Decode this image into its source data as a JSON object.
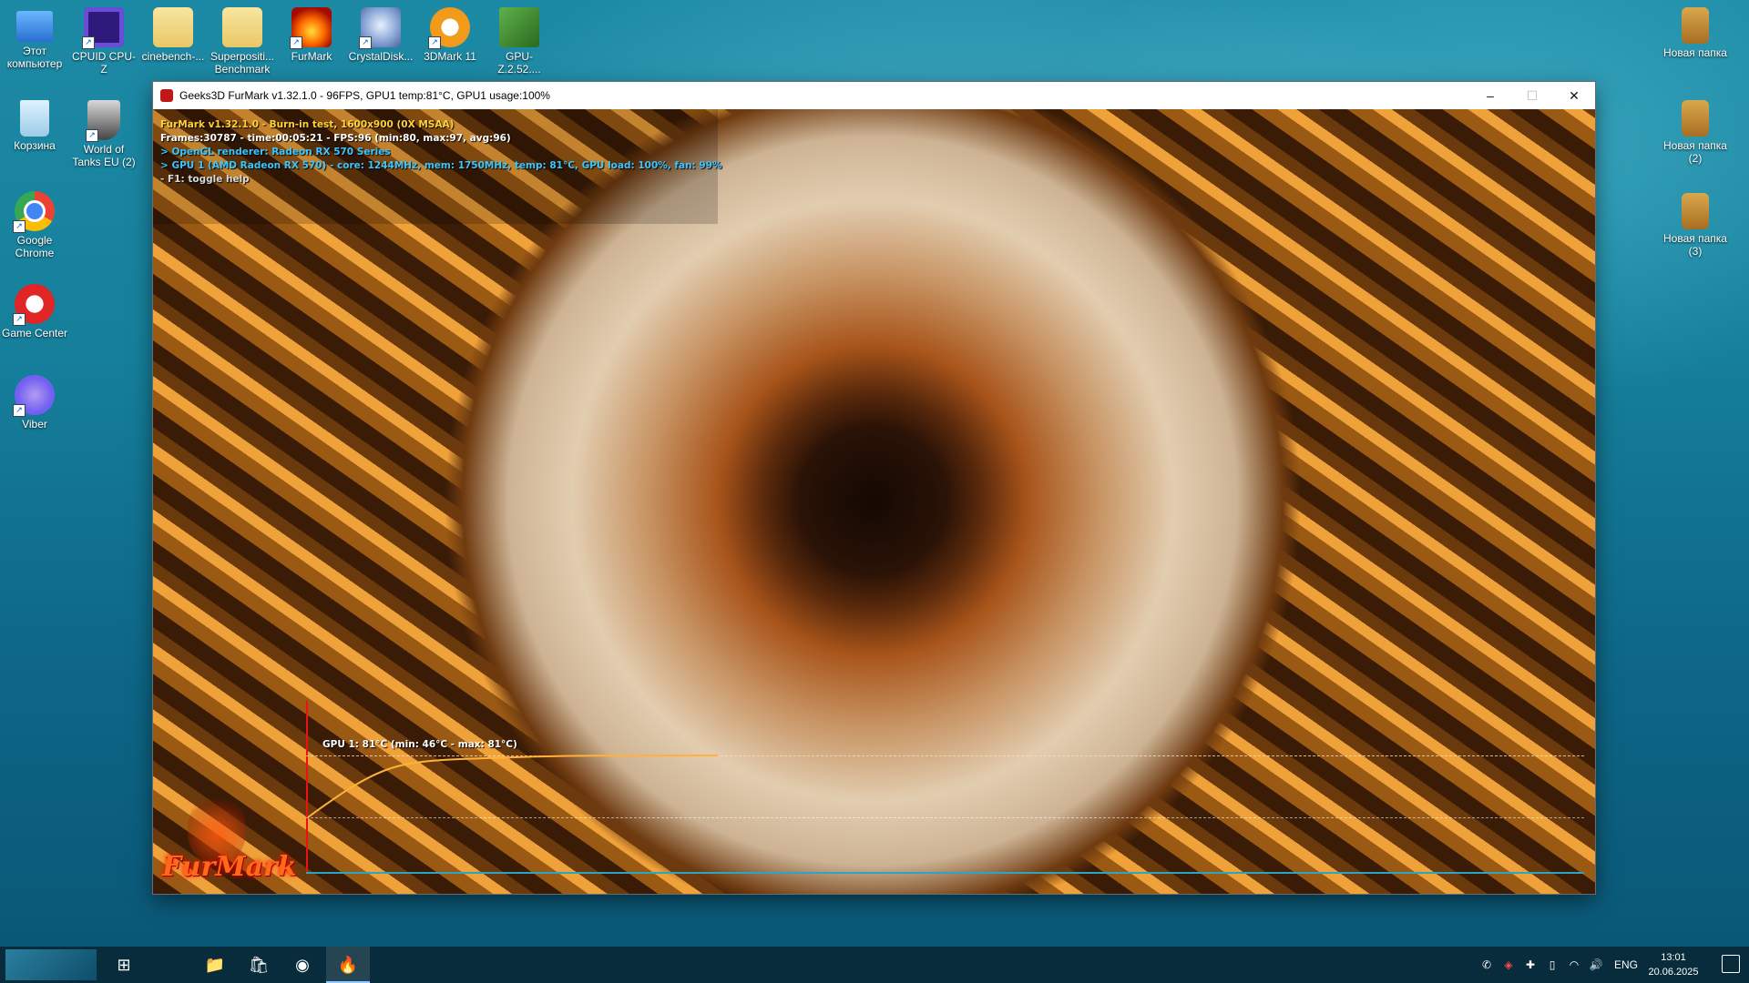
{
  "desktop": {
    "left_icons": [
      {
        "label": "Этот компьютер",
        "icon": "computer-icon"
      },
      {
        "label": "CPUID CPU-Z",
        "icon": "cpu-z-icon"
      },
      {
        "label": "cinebench-...",
        "icon": "folder-icon"
      },
      {
        "label": "Superpositi... Benchmark",
        "icon": "folder-icon"
      },
      {
        "label": "FurMark",
        "icon": "furmark-icon"
      },
      {
        "label": "CrystalDisk...",
        "icon": "crystaldisk-icon"
      },
      {
        "label": "3DMark 11",
        "icon": "3dmark-icon"
      },
      {
        "label": "GPU-Z.2.52....",
        "icon": "gpu-z-icon"
      },
      {
        "label": "Корзина",
        "icon": "recycle-bin-icon"
      },
      {
        "label": "World of Tanks EU (2)",
        "icon": "world-of-tanks-icon"
      },
      {
        "label": "Google Chrome",
        "icon": "chrome-icon"
      },
      {
        "label": "Game Center",
        "icon": "game-center-icon"
      },
      {
        "label": "Viber",
        "icon": "viber-icon"
      }
    ],
    "right_icons": [
      {
        "label": "Новая папка",
        "icon": "folder-icon"
      },
      {
        "label": "Новая папка (2)",
        "icon": "folder-icon"
      },
      {
        "label": "Новая папка (3)",
        "icon": "folder-icon"
      }
    ]
  },
  "window": {
    "title": "Geeks3D FurMark v1.32.1.0 - 96FPS, GPU1 temp:81°C, GPU1 usage:100%",
    "minimize_glyph": "–",
    "maximize_glyph": "☐",
    "close_glyph": "✕",
    "hud": {
      "line1": "FurMark v1.32.1.0 - Burn-in test, 1600x900 (0X MSAA)",
      "line2": "Frames:30787 - time:00:05:21 - FPS:96 (min:80, max:97, avg:96)",
      "line3": "> OpenGL renderer: Radeon RX 570 Series",
      "line4": "> GPU 1 (AMD Radeon RX 570) - core: 1244MHz, mem: 1750MHz, temp: 81°C, GPU load: 100%, fan: 99%",
      "line5": "- F1: toggle help"
    },
    "graph_label": "GPU 1: 81°C (min: 46°C - max: 81°C)",
    "logo_text": "FurMark"
  },
  "colors": {
    "hud_yellow": "#ffd23a",
    "hud_white": "#ffffff",
    "hud_cyan": "#3cc6ff",
    "hud_gray": "#d8d8d8",
    "graph_red": "#e11111",
    "graph_cyan": "#2aa6c4",
    "curve_orange": "#ffb13a"
  },
  "taskbar": {
    "language": "ENG",
    "time": "13:01",
    "date": "20.06.2025",
    "items": [
      {
        "name": "task-view",
        "icon": "task-view-icon",
        "glyph": "⊞"
      },
      {
        "name": "file-explorer",
        "icon": "folder-icon",
        "glyph": "📁"
      },
      {
        "name": "store",
        "icon": "store-icon",
        "glyph": "🛍"
      },
      {
        "name": "chrome",
        "icon": "chrome-icon",
        "glyph": "◉"
      },
      {
        "name": "furmark",
        "icon": "furmark-icon",
        "glyph": "🔥"
      }
    ],
    "tray_glyphs": [
      "✆",
      "◈",
      "✚",
      "▯",
      "◠",
      "🔊"
    ]
  }
}
